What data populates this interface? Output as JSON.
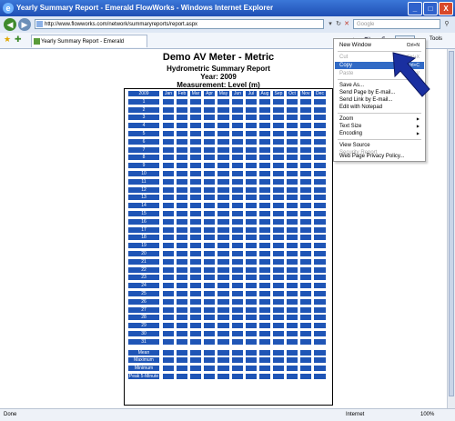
{
  "window": {
    "title": "Yearly Summary Report - Emerald FlowWorks - Windows Internet Explorer",
    "min_label": "_",
    "max_label": "□",
    "close_label": "X"
  },
  "address": {
    "url": "http://www.flowworks.com/network/summaryreports/report.aspx",
    "search_placeholder": "Google"
  },
  "tab": {
    "label": "Yearly Summary Report - Emerald FlowWorks"
  },
  "toolbar": {
    "tools_label": "Tools"
  },
  "report": {
    "title": "Demo AV Meter - Metric",
    "subtitle": "Hydrometric Summary Report",
    "year": "Year: 2009",
    "measurement": "Measurement: Level (m)"
  },
  "table": {
    "corner": "2009",
    "months": [
      "Jan",
      "Feb",
      "Mar",
      "Apr",
      "May",
      "Jun",
      "Jul",
      "Aug",
      "Sep",
      "Oct",
      "Nov",
      "Dec"
    ],
    "days": [
      "1",
      "2",
      "3",
      "4",
      "5",
      "6",
      "7",
      "8",
      "9",
      "10",
      "11",
      "12",
      "13",
      "14",
      "15",
      "16",
      "17",
      "18",
      "19",
      "20",
      "21",
      "22",
      "23",
      "24",
      "25",
      "26",
      "27",
      "28",
      "29",
      "30",
      "31"
    ],
    "stats": [
      "Mean",
      "Maximum",
      "Minimum",
      "Peak 5-Minute"
    ]
  },
  "context_menu": {
    "items": [
      {
        "label": "New Window",
        "shortcut": "Ctrl+N"
      },
      {
        "label": "Cut",
        "shortcut": "Ctrl+X"
      },
      {
        "label": "Copy",
        "shortcut": "Ctrl+C"
      },
      {
        "label": "Paste",
        "shortcut": "Ctrl+V"
      },
      {
        "label": "Save As..."
      },
      {
        "label": "Send Page by E-mail..."
      },
      {
        "label": "Send Link by E-mail..."
      },
      {
        "label": "Edit with Notepad"
      },
      {
        "label": "Zoom"
      },
      {
        "label": "Text Size"
      },
      {
        "label": "Encoding"
      },
      {
        "label": "View Source"
      },
      {
        "label": "Security Report"
      },
      {
        "label": "Web Page Privacy Policy..."
      }
    ]
  },
  "status": {
    "left": "Done",
    "zone": "Internet",
    "zoom": "100%"
  }
}
